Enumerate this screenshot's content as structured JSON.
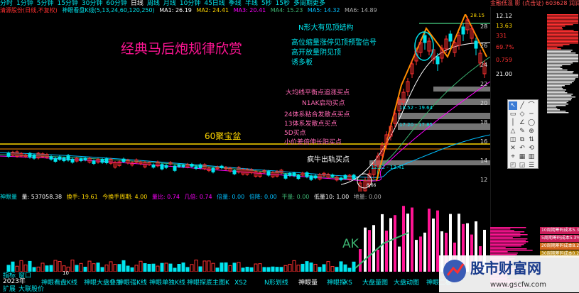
{
  "periods": [
    "分时",
    "1分钟",
    "5分钟",
    "15分钟",
    "30分钟",
    "60分钟",
    "日线",
    "周线",
    "月线",
    "10分钟",
    "45日线",
    "季线",
    "半线",
    "5秒",
    "15秒",
    "多周期更多"
  ],
  "active_period": "日线",
  "right_info": "金融低温 影  (点击证)  603628  润润股份",
  "main_legend": {
    "stock": "清源股份(日线,不复权)",
    "indicator": "神眼看盘K线(5,13,24,60,120,250)",
    "ma1": "MA1: 26.19",
    "ma2": "MA2: 24.41",
    "ma3": "MA3: 20.41",
    "ma4": "MA4: 15.23",
    "ma5": "MA5: 14.32",
    "ma6": "MA6: 14.89"
  },
  "title": "经典马后炮规律欣赏",
  "annotations": {
    "n_shape": "N形大有见顶结构",
    "high_warning": "高位缩量涨停见顶预警信号",
    "high_open": "高开放量阴见顶",
    "lure": "诱多板",
    "avg_balance": "大均线平衡点追涨买点",
    "n1ak": "N1AK启动买点",
    "sys24": "24体系粘合发散点买点",
    "sys13": "13体系发散点买点",
    "d5": "5D买点",
    "small_diff": "小价差倍伸长阳买点",
    "treasure": "60聚宝盆",
    "bull": "疯牛出轨买点",
    "ak": "AK",
    "range1": "18.52 - 19.64",
    "range2": "17.20 - 17.85",
    "range3": "12.92 - 13.41",
    "peak": "28.15",
    "low": "8.66"
  },
  "y_ticks": [
    "28",
    "26",
    "24",
    "22",
    "20",
    "18",
    "16",
    "14",
    "12"
  ],
  "right_prices": [
    "12.12",
    "13.63",
    "331",
    "69.7%",
    "0.759",
    "21.00"
  ],
  "vol_legend": {
    "name": "神眼量",
    "vol": "量: 537058.38",
    "turnover": "换手: 19.61",
    "rise": "今换手周期: 4.00",
    "ratio": "量比: 0.74",
    "ratio2": "几倍: 0.74",
    "beishu": "倍量: 0.00",
    "fanbei": "倍降: 0.00",
    "ping": "平量: 0.00",
    "di": "低量10: 1.00",
    "di2": "地量: 0.00"
  },
  "bottom_tabs": [
    "神眼看盘K线",
    "神眼大盘叠加",
    "神眼强K线",
    "神眼单独K线",
    "神眼探底主图K",
    "XS2",
    "N形划线",
    "神眼量",
    "神眼探",
    "XS",
    "大盘量图",
    "大盘动图",
    "神眼二板"
  ],
  "bottom_row1": [
    "指标",
    "窗口"
  ],
  "bottom_row2": [
    "扩展",
    "大联股价"
  ],
  "date_label": "2023年",
  "date_tick": "10",
  "legend_box": [
    {
      "label": "10周期筹码成本5.3%",
      "color": "#c81e5a"
    },
    {
      "label": "5周期筹码成本5.3%",
      "color": "#c81e5a"
    },
    {
      "label": "20周期筹码成本8.2%",
      "color": "#d2691e"
    },
    {
      "label": "30周期筹码成本0.2%",
      "color": "#b8860b"
    }
  ],
  "watermark": {
    "brand": "股市财富网",
    "url": "www.gscfw.com"
  },
  "chart_colors": {
    "up": "#ff3030",
    "down": "#00e5ee",
    "ma_yellow": "#ffd700",
    "ma_white": "#ffffff",
    "ma_green": "#3cb371",
    "ma_magenta": "#ff00ff"
  }
}
